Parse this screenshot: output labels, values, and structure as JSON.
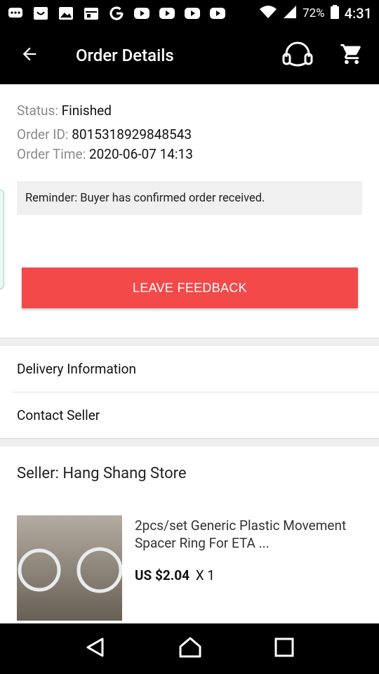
{
  "status_bar": {
    "battery": "72%",
    "time": "4:31",
    "left_icons": [
      "messenger-icon",
      "smiley-icon",
      "image-icon",
      "calendar-icon",
      "google-icon",
      "youtube-icon",
      "youtube-icon",
      "youtube-icon",
      "youtube-icon"
    ]
  },
  "app_bar": {
    "title": "Order Details",
    "back_icon": "arrow-back-icon",
    "support_icon": "headset-icon",
    "cart_icon": "cart-icon"
  },
  "order": {
    "status_label": "Status:",
    "status_value": "Finished",
    "id_label": "Order ID:",
    "id_value": "8015318929848543",
    "time_label": "Order Time:",
    "time_value": "2020-06-07 14:13",
    "reminder": "Reminder: Buyer has confirmed order received."
  },
  "actions": {
    "leave_feedback": "LEAVE FEEDBACK"
  },
  "menu": {
    "delivery": "Delivery Information",
    "contact": "Contact Seller"
  },
  "seller": {
    "label": "Seller: Hang Shang Store"
  },
  "product": {
    "title": "2pcs/set Generic Plastic Movement Spacer Ring For ETA ...",
    "price": "US $2.04",
    "quantity": "X 1"
  },
  "colors": {
    "accent": "#f44949",
    "bar_bg": "#000000"
  }
}
